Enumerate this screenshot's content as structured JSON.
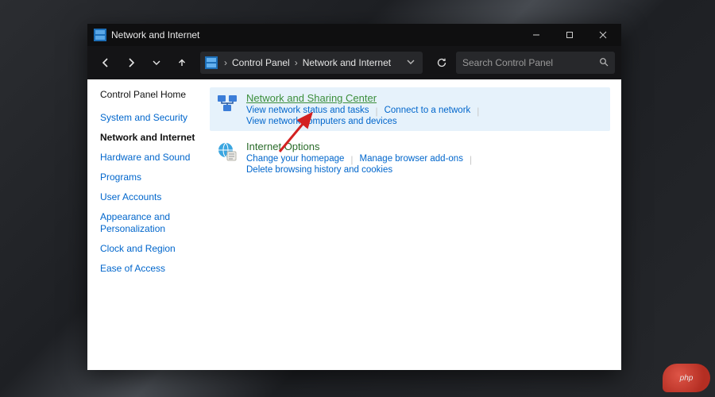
{
  "titlebar": {
    "title": "Network and Internet"
  },
  "breadcrumb": {
    "root": "Control Panel",
    "current": "Network and Internet"
  },
  "search": {
    "placeholder": "Search Control Panel"
  },
  "sidebar": {
    "home": "Control Panel Home",
    "items": [
      "System and Security",
      "Network and Internet",
      "Hardware and Sound",
      "Programs",
      "User Accounts",
      "Appearance and Personalization",
      "Clock and Region",
      "Ease of Access"
    ],
    "activeIndex": 1
  },
  "main": {
    "groups": [
      {
        "title": "Network and Sharing Center",
        "links": [
          "View network status and tasks",
          "Connect to a network",
          "View network computers and devices"
        ]
      },
      {
        "title": "Internet Options",
        "links": [
          "Change your homepage",
          "Manage browser add-ons",
          "Delete browsing history and cookies"
        ]
      }
    ]
  },
  "watermark": "php"
}
